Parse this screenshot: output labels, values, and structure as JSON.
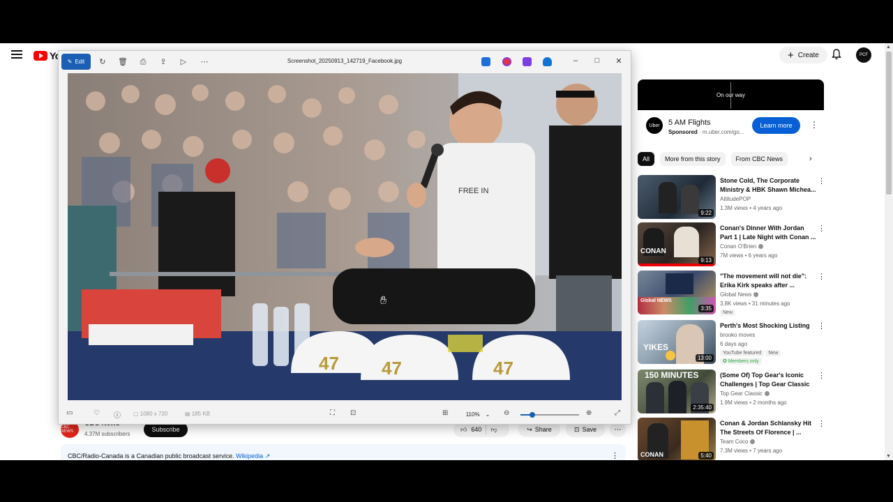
{
  "youtube": {
    "logo_text": "Yo",
    "create_label": "Create",
    "avatar_text": "PCF"
  },
  "ad": {
    "banner_text": "On our way",
    "logo_text": "Uber",
    "title": "5 AM Flights",
    "sponsored": "Sponsored",
    "url": "m.uber.com/go...",
    "cta": "Learn more"
  },
  "chips": [
    "All",
    "More from this story",
    "From CBC News"
  ],
  "recommendations": [
    {
      "title": "Stone Cold, The Corporate Ministry & HBK Shawn Michea...",
      "channel": "AttitudePOP",
      "meta": "1.3M views • 4 years ago",
      "duration": "9:22",
      "thumb_text": "",
      "badges": []
    },
    {
      "title": "Conan's Dinner With Jordan Part 1 | Late Night with Conan ...",
      "channel": "Conan O'Brien",
      "meta": "7M views • 6 years ago",
      "duration": "9:13",
      "thumb_text": "CONAN",
      "badges": []
    },
    {
      "title": "\"The movement will not die\": Erika Kirk speaks after ...",
      "channel": "Global News",
      "meta": "3.8K views • 31 minutes ago",
      "duration": "3:35",
      "thumb_text": "Global NEWS",
      "badges": [
        "New"
      ]
    },
    {
      "title": "Perth's Most Shocking Listing",
      "channel": "brooko moves",
      "meta": "6 days ago",
      "duration": "13:00",
      "thumb_text": "YIKES",
      "badges": [
        "YouTube featured",
        "New",
        "Members only"
      ]
    },
    {
      "title": "(Some Of) Top Gear's Iconic Challenges | Top Gear Classic",
      "channel": "Top Gear Classic",
      "meta": "1.9M views • 2 months ago",
      "duration": "2:35:40",
      "thumb_text": "150 MINUTES",
      "badges": []
    },
    {
      "title": "Conan & Jordan Schlansky Hit The Streets Of Florence | ...",
      "channel": "Team Coco",
      "meta": "7.3M views • 7 years ago",
      "duration": "5:40",
      "thumb_text": "CONAN",
      "badges": []
    }
  ],
  "channel": {
    "logo_text": "CBC NEWS",
    "name": "CBC News",
    "subs": "4.37M subscribers",
    "subscribe": "Subscribe",
    "likes": "640",
    "share": "Share",
    "save": "Save"
  },
  "info": {
    "text": "CBC/Radio-Canada is a Canadian public broadcast service.",
    "link": "Wikipedia"
  },
  "viewer": {
    "edit_label": "Edit",
    "file_name": "Screenshot_20250913_142719_Facebook.jpg",
    "dimensions": "1080 x 720",
    "file_size": "185 KB",
    "zoom": "110%",
    "zoom_fraction": 0.2,
    "photo_caps_text": "47",
    "photo_shirt_text": "FREE IN"
  },
  "colors": {
    "yt_red": "#ff0000",
    "learn_blue": "#065fd4",
    "edit_blue": "#1a5fb4",
    "cbc_red": "#e1251b"
  }
}
